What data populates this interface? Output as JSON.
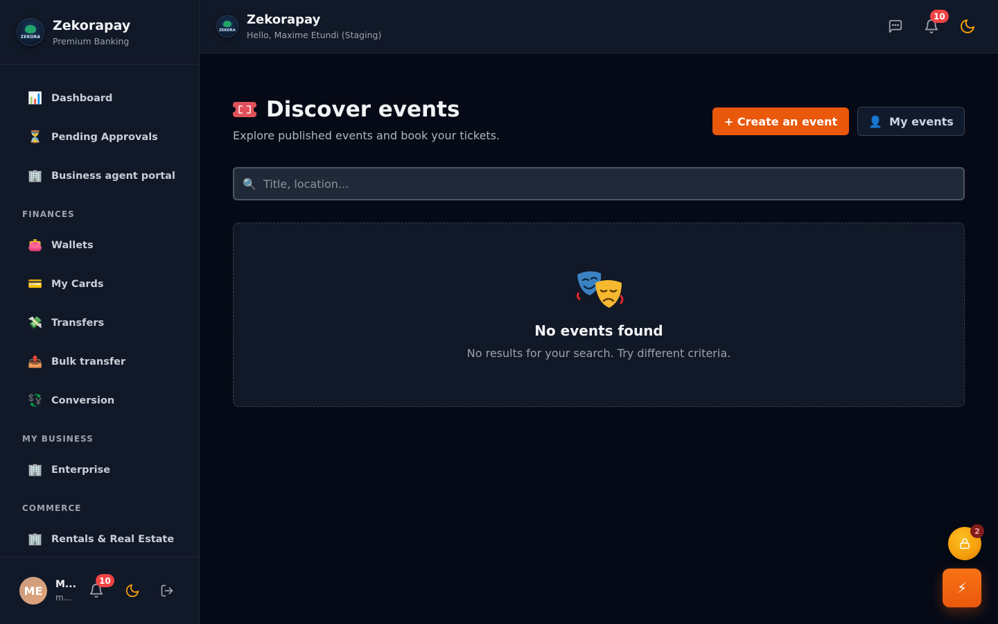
{
  "app": {
    "name": "Zekorapay",
    "tagline": "Premium Banking",
    "logo_text": "ZEKORA"
  },
  "header": {
    "title": "Zekorapay",
    "subtitle": "Hello, Maxime Etundi (Staging)",
    "notification_count": "10"
  },
  "sidebar": {
    "items": [
      {
        "label": "Dashboard",
        "icon": "📊"
      },
      {
        "label": "Pending Approvals",
        "icon": "⏳"
      },
      {
        "label": "Business agent portal",
        "icon": "🏢"
      }
    ],
    "sections": [
      {
        "title": "FINANCES",
        "items": [
          {
            "label": "Wallets",
            "icon": "👛"
          },
          {
            "label": "My Cards",
            "icon": "💳"
          },
          {
            "label": "Transfers",
            "icon": "💸"
          },
          {
            "label": "Bulk transfer",
            "icon": "📤"
          },
          {
            "label": "Conversion",
            "icon": "💱"
          }
        ]
      },
      {
        "title": "MY BUSINESS",
        "items": [
          {
            "label": "Enterprise",
            "icon": "🏢"
          }
        ]
      },
      {
        "title": "COMMERCE",
        "items": [
          {
            "label": "Rentals & Real Estate",
            "icon": "🏢"
          }
        ]
      }
    ],
    "user": {
      "initials": "ME",
      "name": "M...",
      "email": "m..."
    },
    "notification_count": "10"
  },
  "main": {
    "title": "Discover events",
    "subtitle": "Explore published events and book your tickets.",
    "create_button": "+ Create an event",
    "my_events_button": "My events",
    "my_events_icon": "👤",
    "search": {
      "icon": "🔍",
      "placeholder": "Title, location...",
      "value": ""
    },
    "empty": {
      "icon": "🎭",
      "title": "No events found",
      "message": "No results for your search. Try different criteria."
    }
  },
  "fab": {
    "lock_badge": "2",
    "bolt": "⚡"
  },
  "colors": {
    "accent": "#ea580c",
    "badge": "#ef4444",
    "bg": "#050a16",
    "panel": "#111827"
  }
}
